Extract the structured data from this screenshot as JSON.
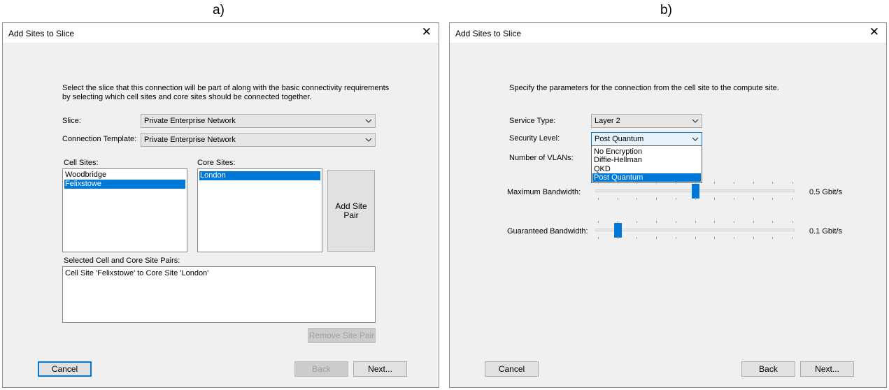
{
  "panel_a": {
    "label": "a)",
    "title": "Add Sites to Slice",
    "description": "Select the slice that this connection will be part of along with the basic connectivity requirements\nby selecting which cell sites and core sites should be connected together.",
    "slice_label": "Slice:",
    "slice_value": "Private Enterprise Network",
    "template_label": "Connection Template:",
    "template_value": "Private Enterprise Network",
    "cell_sites_label": "Cell Sites:",
    "cell_sites": [
      "Woodbridge",
      "Felixstowe"
    ],
    "cell_sites_selected": 1,
    "core_sites_label": "Core Sites:",
    "core_sites": [
      "London"
    ],
    "core_sites_selected": 0,
    "add_pair_label": "Add Site\nPair",
    "pairs_label": "Selected Cell and Core Site Pairs:",
    "pairs": [
      "Cell Site 'Felixstowe' to Core Site 'London'"
    ],
    "remove_pair_label": "Remove Site Pair",
    "cancel_label": "Cancel",
    "back_label": "Back",
    "next_label": "Next..."
  },
  "panel_b": {
    "label": "b)",
    "title": "Add Sites to Slice",
    "description": "Specify the parameters for the connection from the cell site to the compute site.",
    "service_type_label": "Service Type:",
    "service_type_value": "Layer 2",
    "security_level_label": "Security Level:",
    "security_level_value": "Post Quantum",
    "security_options": [
      "No Encryption",
      "Diffie-Hellman",
      "QKD",
      "Post Quantum"
    ],
    "security_selected": 3,
    "vlans_label": "Number of VLANs:",
    "max_bw_label": "Maximum Bandwidth:",
    "max_bw_value": "0.5 Gbit/s",
    "max_bw_fraction": 0.5,
    "guar_bw_label": "Guaranteed Bandwidth:",
    "guar_bw_value": "0.1 Gbit/s",
    "guar_bw_fraction": 0.1,
    "cancel_label": "Cancel",
    "back_label": "Back",
    "next_label": "Next..."
  }
}
